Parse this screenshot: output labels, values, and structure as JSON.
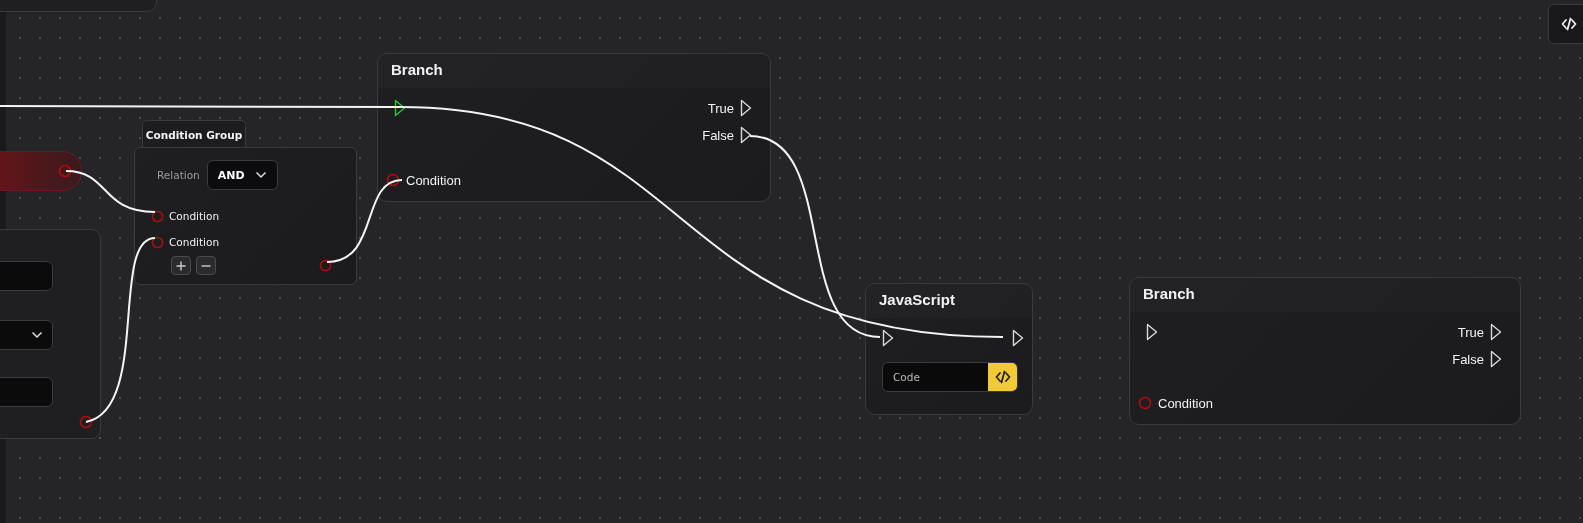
{
  "nodes": [
    {
      "kind": "condition_group",
      "title": "Condition Group",
      "relation_label": "Relation",
      "relation": "AND",
      "inputs": [
        "Condition",
        "Condition"
      ]
    },
    {
      "kind": "branch",
      "title": "Branch",
      "exec_in_active": true,
      "outputs": [
        "True",
        "False"
      ],
      "input": "Condition"
    },
    {
      "kind": "javascript",
      "title": "JavaScript",
      "code_placeholder": "Code"
    },
    {
      "kind": "branch",
      "title": "Branch",
      "exec_in_active": false,
      "outputs": [
        "True",
        "False"
      ],
      "input": "Condition"
    }
  ]
}
